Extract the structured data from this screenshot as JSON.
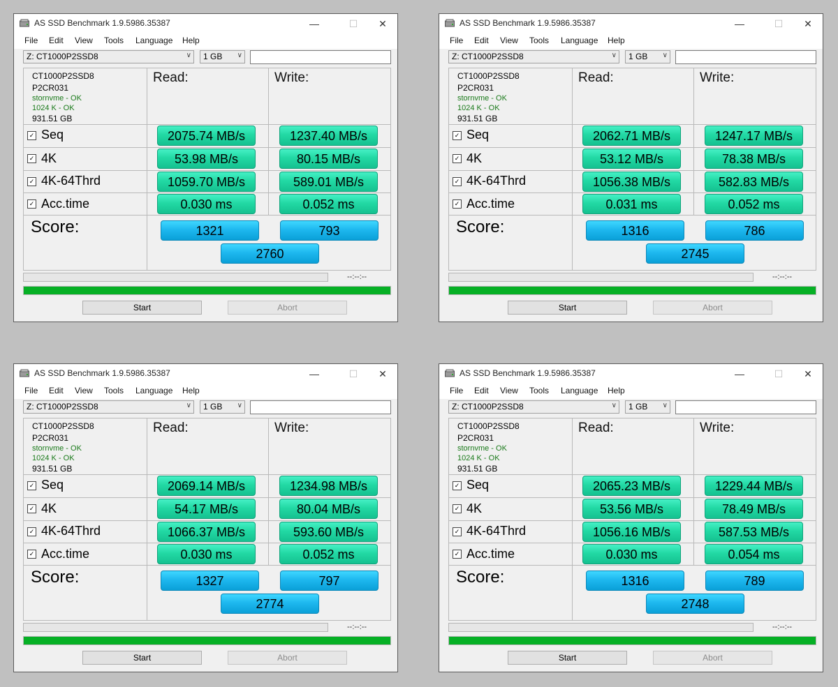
{
  "windows": [
    {
      "title": "AS SSD Benchmark 1.9.5986.35387",
      "menu": [
        "File",
        "Edit",
        "View",
        "Tools",
        "Language",
        "Help"
      ],
      "drive": "Z: CT1000P2SSD8",
      "test_size": "1 GB",
      "text_box_value": "",
      "info": {
        "model": "CT1000P2SSD8",
        "firmware": "P2CR031",
        "driver_status": "stornvme - OK",
        "alignment_status": "1024 K - OK",
        "capacity": "931.51 GB"
      },
      "read_header": "Read:",
      "write_header": "Write:",
      "rows": [
        {
          "label": "Seq",
          "checked": true,
          "read": "2075.74 MB/s",
          "write": "1237.40 MB/s"
        },
        {
          "label": "4K",
          "checked": true,
          "read": "53.98 MB/s",
          "write": "80.15 MB/s"
        },
        {
          "label": "4K-64Thrd",
          "checked": true,
          "read": "1059.70 MB/s",
          "write": "589.01 MB/s"
        },
        {
          "label": "Acc.time",
          "checked": true,
          "read": "0.030 ms",
          "write": "0.052 ms"
        }
      ],
      "score_label": "Score:",
      "score_read": "1321",
      "score_write": "793",
      "score_total": "2760",
      "time": "--:--:--",
      "progress_fraction": 1.0,
      "start_label": "Start",
      "abort_label": "Abort"
    },
    {
      "title": "AS SSD Benchmark 1.9.5986.35387",
      "menu": [
        "File",
        "Edit",
        "View",
        "Tools",
        "Language",
        "Help"
      ],
      "drive": "Z: CT1000P2SSD8",
      "test_size": "1 GB",
      "text_box_value": "",
      "info": {
        "model": "CT1000P2SSD8",
        "firmware": "P2CR031",
        "driver_status": "stornvme - OK",
        "alignment_status": "1024 K - OK",
        "capacity": "931.51 GB"
      },
      "read_header": "Read:",
      "write_header": "Write:",
      "rows": [
        {
          "label": "Seq",
          "checked": true,
          "read": "2062.71 MB/s",
          "write": "1247.17 MB/s"
        },
        {
          "label": "4K",
          "checked": true,
          "read": "53.12 MB/s",
          "write": "78.38 MB/s"
        },
        {
          "label": "4K-64Thrd",
          "checked": true,
          "read": "1056.38 MB/s",
          "write": "582.83 MB/s"
        },
        {
          "label": "Acc.time",
          "checked": true,
          "read": "0.031 ms",
          "write": "0.052 ms"
        }
      ],
      "score_label": "Score:",
      "score_read": "1316",
      "score_write": "786",
      "score_total": "2745",
      "time": "--:--:--",
      "progress_fraction": 1.0,
      "start_label": "Start",
      "abort_label": "Abort"
    },
    {
      "title": "AS SSD Benchmark 1.9.5986.35387",
      "menu": [
        "File",
        "Edit",
        "View",
        "Tools",
        "Language",
        "Help"
      ],
      "drive": "Z: CT1000P2SSD8",
      "test_size": "1 GB",
      "text_box_value": "",
      "info": {
        "model": "CT1000P2SSD8",
        "firmware": "P2CR031",
        "driver_status": "stornvme - OK",
        "alignment_status": "1024 K - OK",
        "capacity": "931.51 GB"
      },
      "read_header": "Read:",
      "write_header": "Write:",
      "rows": [
        {
          "label": "Seq",
          "checked": true,
          "read": "2069.14 MB/s",
          "write": "1234.98 MB/s"
        },
        {
          "label": "4K",
          "checked": true,
          "read": "54.17 MB/s",
          "write": "80.04 MB/s"
        },
        {
          "label": "4K-64Thrd",
          "checked": true,
          "read": "1066.37 MB/s",
          "write": "593.60 MB/s"
        },
        {
          "label": "Acc.time",
          "checked": true,
          "read": "0.030 ms",
          "write": "0.052 ms"
        }
      ],
      "score_label": "Score:",
      "score_read": "1327",
      "score_write": "797",
      "score_total": "2774",
      "time": "--:--:--",
      "progress_fraction": 1.0,
      "start_label": "Start",
      "abort_label": "Abort"
    },
    {
      "title": "AS SSD Benchmark 1.9.5986.35387",
      "menu": [
        "File",
        "Edit",
        "View",
        "Tools",
        "Language",
        "Help"
      ],
      "drive": "Z: CT1000P2SSD8",
      "test_size": "1 GB",
      "text_box_value": "",
      "info": {
        "model": "CT1000P2SSD8",
        "firmware": "P2CR031",
        "driver_status": "stornvme - OK",
        "alignment_status": "1024 K - OK",
        "capacity": "931.51 GB"
      },
      "read_header": "Read:",
      "write_header": "Write:",
      "rows": [
        {
          "label": "Seq",
          "checked": true,
          "read": "2065.23 MB/s",
          "write": "1229.44 MB/s"
        },
        {
          "label": "4K",
          "checked": true,
          "read": "53.56 MB/s",
          "write": "78.49 MB/s"
        },
        {
          "label": "4K-64Thrd",
          "checked": true,
          "read": "1056.16 MB/s",
          "write": "587.53 MB/s"
        },
        {
          "label": "Acc.time",
          "checked": true,
          "read": "0.030 ms",
          "write": "0.054 ms"
        }
      ],
      "score_label": "Score:",
      "score_read": "1316",
      "score_write": "789",
      "score_total": "2748",
      "time": "--:--:--",
      "progress_fraction": 1.0,
      "start_label": "Start",
      "abort_label": "Abort"
    }
  ]
}
